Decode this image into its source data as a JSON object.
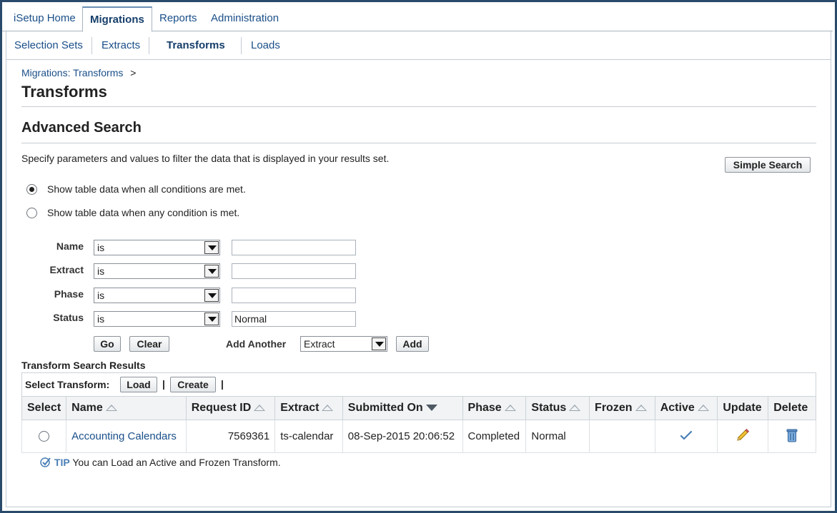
{
  "tabs": [
    {
      "label": "iSetup Home"
    },
    {
      "label": "Migrations"
    },
    {
      "label": "Reports"
    },
    {
      "label": "Administration"
    }
  ],
  "subtabs": [
    {
      "label": "Selection Sets"
    },
    {
      "label": "Extracts"
    },
    {
      "label": "Transforms"
    },
    {
      "label": "Loads"
    }
  ],
  "breadcrumb": {
    "link": "Migrations: Transforms",
    "separator": ">"
  },
  "page_title": "Transforms",
  "search": {
    "heading": "Advanced Search",
    "instructions": "Specify parameters and values to filter the data that is displayed in your results set.",
    "simple_search_label": "Simple Search",
    "match_all_label": "Show table data when all conditions are met.",
    "match_any_label": "Show table data when any condition is met.",
    "conditions": [
      {
        "label": "Name",
        "operator": "is",
        "value": ""
      },
      {
        "label": "Extract",
        "operator": "is",
        "value": ""
      },
      {
        "label": "Phase",
        "operator": "is",
        "value": ""
      },
      {
        "label": "Status",
        "operator": "is",
        "value": "Normal"
      }
    ],
    "go_label": "Go",
    "clear_label": "Clear",
    "add_another_label": "Add Another",
    "add_another_value": "Extract",
    "add_label": "Add"
  },
  "results": {
    "heading": "Transform Search Results",
    "select_label": "Select Transform:",
    "load_label": "Load",
    "create_label": "Create",
    "pipe": "|",
    "columns": [
      "Select",
      "Name",
      "Request ID",
      "Extract",
      "Submitted On",
      "Phase",
      "Status",
      "Frozen",
      "Active",
      "Update",
      "Delete"
    ],
    "rows": [
      {
        "name": "Accounting Calendars",
        "request_id": "7569361",
        "extract": "ts-calendar",
        "submitted_on": "08-Sep-2015 20:06:52",
        "phase": "Completed",
        "status": "Normal",
        "frozen": "",
        "active": true
      }
    ]
  },
  "tip": {
    "label": "TIP",
    "text": "You can Load an Active and Frozen Transform."
  },
  "colors": {
    "link": "#1a4f89",
    "accent": "#4a7fb5",
    "frame": "#2a4a6b"
  }
}
